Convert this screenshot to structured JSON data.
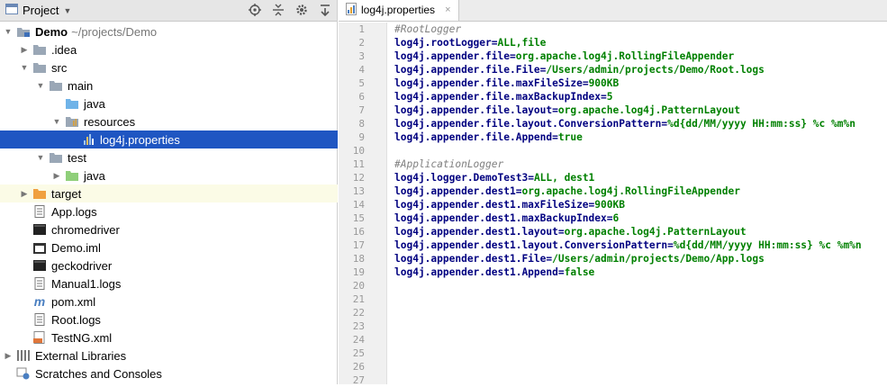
{
  "project_panel": {
    "title": "Project",
    "tree": [
      {
        "label": "Demo",
        "path": "~/projects/Demo",
        "depth": 0,
        "arrow": "down",
        "icon": "module",
        "bold": true
      },
      {
        "label": ".idea",
        "depth": 1,
        "arrow": "right",
        "icon": "folder-gray"
      },
      {
        "label": "src",
        "depth": 1,
        "arrow": "down",
        "icon": "folder-gray"
      },
      {
        "label": "main",
        "depth": 2,
        "arrow": "down",
        "icon": "folder-gray"
      },
      {
        "label": "java",
        "depth": 3,
        "arrow": "none",
        "icon": "folder-blue"
      },
      {
        "label": "resources",
        "depth": 3,
        "arrow": "down",
        "icon": "folder-resources"
      },
      {
        "label": "log4j.properties",
        "depth": 4,
        "arrow": "none",
        "icon": "properties",
        "selected": true
      },
      {
        "label": "test",
        "depth": 2,
        "arrow": "down",
        "icon": "folder-gray"
      },
      {
        "label": "java",
        "depth": 3,
        "arrow": "right",
        "icon": "folder-green"
      },
      {
        "label": "target",
        "depth": 1,
        "arrow": "right",
        "icon": "folder-orange",
        "excluded": true
      },
      {
        "label": "App.logs",
        "depth": 1,
        "arrow": "none",
        "icon": "text-file"
      },
      {
        "label": "chromedriver",
        "depth": 1,
        "arrow": "none",
        "icon": "exec-file"
      },
      {
        "label": "Demo.iml",
        "depth": 1,
        "arrow": "none",
        "icon": "iml-file"
      },
      {
        "label": "geckodriver",
        "depth": 1,
        "arrow": "none",
        "icon": "exec-file"
      },
      {
        "label": "Manual1.logs",
        "depth": 1,
        "arrow": "none",
        "icon": "text-file"
      },
      {
        "label": "pom.xml",
        "depth": 1,
        "arrow": "none",
        "icon": "maven"
      },
      {
        "label": "Root.logs",
        "depth": 1,
        "arrow": "none",
        "icon": "text-file"
      },
      {
        "label": "TestNG.xml",
        "depth": 1,
        "arrow": "none",
        "icon": "xml-file"
      },
      {
        "label": "External Libraries",
        "depth": 0,
        "arrow": "right",
        "icon": "libraries"
      },
      {
        "label": "Scratches and Consoles",
        "depth": 0,
        "arrow": "none",
        "icon": "scratches"
      }
    ]
  },
  "editor": {
    "tab": {
      "label": "log4j.properties",
      "close": "×"
    },
    "line_count": 27,
    "lines": [
      {
        "type": "comment",
        "text": "#RootLogger"
      },
      {
        "type": "prop",
        "key": "log4j.rootLogger",
        "value": "ALL,file"
      },
      {
        "type": "prop",
        "key": "log4j.appender.file",
        "value": "org.apache.log4j.RollingFileAppender"
      },
      {
        "type": "prop",
        "key": "log4j.appender.file.File",
        "value": "/Users/admin/projects/Demo/Root.logs"
      },
      {
        "type": "prop",
        "key": "log4j.appender.file.maxFileSize",
        "value": "900KB"
      },
      {
        "type": "prop",
        "key": "log4j.appender.file.maxBackupIndex",
        "value": "5"
      },
      {
        "type": "prop",
        "key": "log4j.appender.file.layout",
        "value": "org.apache.log4j.PatternLayout"
      },
      {
        "type": "prop",
        "key": "log4j.appender.file.layout.ConversionPattern",
        "value": "%d{dd/MM/yyyy HH:mm:ss} %c %m%n"
      },
      {
        "type": "prop",
        "key": "log4j.appender.file.Append",
        "value": "true"
      },
      {
        "type": "blank"
      },
      {
        "type": "comment",
        "text": "#ApplicationLogger"
      },
      {
        "type": "prop",
        "key": "log4j.logger.DemoTest3",
        "value": "ALL, dest1"
      },
      {
        "type": "prop",
        "key": "log4j.appender.dest1",
        "value": "org.apache.log4j.RollingFileAppender"
      },
      {
        "type": "prop",
        "key": "log4j.appender.dest1.maxFileSize",
        "value": "900KB"
      },
      {
        "type": "prop",
        "key": "log4j.appender.dest1.maxBackupIndex",
        "value": "6"
      },
      {
        "type": "prop",
        "key": "log4j.appender.dest1.layout",
        "value": "org.apache.log4j.PatternLayout"
      },
      {
        "type": "prop",
        "key": "log4j.appender.dest1.layout.ConversionPattern",
        "value": "%d{dd/MM/yyyy HH:mm:ss} %c %m%n"
      },
      {
        "type": "prop",
        "key": "log4j.appender.dest1.File",
        "value": "/Users/admin/projects/Demo/App.logs"
      },
      {
        "type": "prop",
        "key": "log4j.appender.dest1.Append",
        "value": "false"
      }
    ]
  },
  "colors": {
    "selection": "#1f56c2",
    "key": "#000080",
    "value": "#008000",
    "comment": "#808080"
  }
}
